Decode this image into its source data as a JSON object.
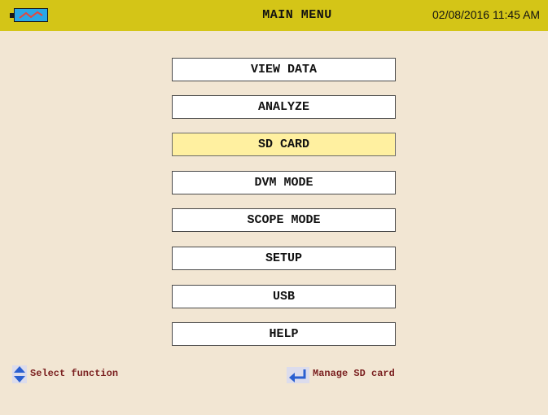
{
  "header": {
    "title": "MAIN MENU",
    "datetime": "02/08/2016 11:45 AM",
    "battery_icon": "battery-charging-icon"
  },
  "menu": {
    "items": [
      {
        "label": "VIEW DATA",
        "selected": false
      },
      {
        "label": "ANALYZE",
        "selected": false
      },
      {
        "label": "SD CARD",
        "selected": true
      },
      {
        "label": "DVM MODE",
        "selected": false
      },
      {
        "label": "SCOPE MODE",
        "selected": false
      },
      {
        "label": "SETUP",
        "selected": false
      },
      {
        "label": "USB",
        "selected": false
      },
      {
        "label": "HELP",
        "selected": false
      }
    ]
  },
  "footer": {
    "select_hint": "Select function",
    "select_icon": "up-down-arrows-icon",
    "enter_hint": "Manage SD card",
    "enter_icon": "enter-return-icon"
  },
  "colors": {
    "background": "#f2e6d3",
    "header": "#d4c517",
    "selected_item": "#fff0a0",
    "hint_text": "#7a1f1f",
    "icon_blue": "#2a5fd0"
  }
}
